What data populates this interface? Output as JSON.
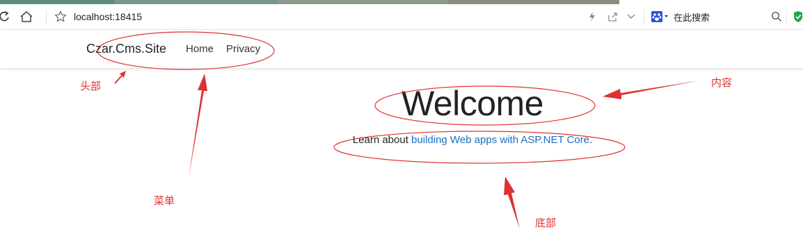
{
  "browser": {
    "address": "localhost:18415",
    "search_engine_label": "在此搜索"
  },
  "site": {
    "brand": "Czar.Cms.Site",
    "nav": [
      {
        "label": "Home"
      },
      {
        "label": "Privacy"
      }
    ],
    "welcome_title": "Welcome",
    "learn_prefix": "Learn about ",
    "learn_link": "building Web apps with ASP.NET Core",
    "learn_suffix": "."
  },
  "annotations": {
    "header": "头部",
    "menu": "菜单",
    "content": "内容",
    "footer": "底部"
  },
  "colors": {
    "annotation_red": "#e03030",
    "link_blue": "#1b6ec2"
  }
}
